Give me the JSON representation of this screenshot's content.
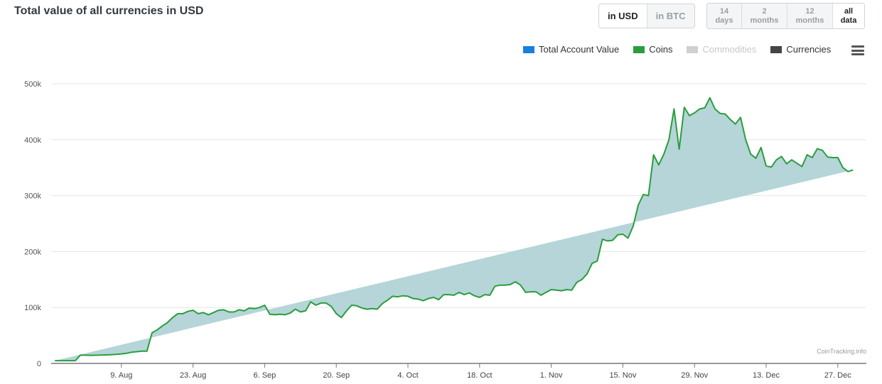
{
  "header": {
    "title": "Total value of all currencies in USD"
  },
  "currency_toggle": [
    {
      "label": "in USD",
      "active": true
    },
    {
      "label": "in BTC",
      "active": false
    }
  ],
  "range_buttons": [
    {
      "line1": "14",
      "line2": "days",
      "active": false
    },
    {
      "line1": "2",
      "line2": "months",
      "active": false
    },
    {
      "line1": "12",
      "line2": "months",
      "active": false
    },
    {
      "line1": "all",
      "line2": "data",
      "active": true
    }
  ],
  "legend": [
    {
      "label": "Total Account Value",
      "color": "#1a7fe0",
      "enabled": true
    },
    {
      "label": "Coins",
      "color": "#2a9d3e",
      "enabled": true
    },
    {
      "label": "Commodities",
      "color": "#d0d0d0",
      "enabled": false
    },
    {
      "label": "Currencies",
      "color": "#444444",
      "enabled": true
    }
  ],
  "credits": "CoinTracking.info",
  "chart_data": {
    "type": "area",
    "ylim": [
      0,
      500000
    ],
    "y_ticks": [
      0,
      100000,
      200000,
      300000,
      400000,
      500000
    ],
    "y_tick_labels": [
      "0",
      "100k",
      "200k",
      "300k",
      "400k",
      "500k"
    ],
    "x_tick_labels": [
      "9. Aug",
      "23. Aug",
      "6. Sep",
      "20. Sep",
      "4. Oct",
      "18. Oct",
      "1. Nov",
      "15. Nov",
      "29. Nov",
      "13. Dec",
      "27. Dec"
    ],
    "x_tick_days": [
      14,
      28,
      42,
      56,
      70,
      84,
      98,
      112,
      126,
      140,
      154
    ],
    "xlim_days": [
      0,
      157
    ],
    "grid": true,
    "line_color": "#2a9d3e",
    "fill_color": "#b5d5d8",
    "series": [
      {
        "name": "Coins",
        "x_days": [
          1,
          3,
          5,
          6,
          8,
          10,
          12,
          14,
          15,
          16,
          17,
          18,
          19,
          20,
          21,
          22,
          23,
          24,
          25,
          26,
          27,
          28,
          29,
          30,
          31,
          32,
          33,
          34,
          35,
          36,
          37,
          38,
          39,
          40,
          41,
          42,
          43,
          44,
          45,
          46,
          47,
          48,
          49,
          50,
          51,
          52,
          53,
          54,
          55,
          56,
          57,
          58,
          59,
          60,
          61,
          62,
          63,
          64,
          65,
          66,
          67,
          68,
          69,
          70,
          71,
          72,
          73,
          74,
          75,
          76,
          77,
          78,
          79,
          80,
          81,
          82,
          83,
          84,
          85,
          86,
          87,
          88,
          89,
          90,
          91,
          92,
          93,
          94,
          95,
          96,
          97,
          98,
          99,
          100,
          101,
          102,
          103,
          104,
          105,
          106,
          107,
          108,
          109,
          110,
          111,
          112,
          113,
          114,
          115,
          116,
          117,
          118,
          119,
          120,
          121,
          122,
          123,
          124,
          125,
          126,
          127,
          128,
          129,
          130,
          131,
          132,
          133,
          134,
          135,
          136,
          137,
          138,
          139,
          140,
          141,
          142,
          143,
          144,
          145,
          146,
          147,
          148,
          149,
          150,
          151,
          152,
          153,
          154,
          155,
          156,
          157
        ],
        "values": [
          5000,
          5000,
          5000,
          15000,
          14500,
          15000,
          15500,
          17000,
          18000,
          20000,
          21000,
          22000,
          22000,
          55000,
          60000,
          67000,
          73000,
          82000,
          89000,
          89000,
          93000,
          95000,
          89000,
          91000,
          87000,
          91000,
          95000,
          96000,
          92000,
          92000,
          96000,
          94000,
          99000,
          98000,
          100000,
          104000,
          88000,
          87000,
          88000,
          87000,
          90000,
          97000,
          92000,
          94000,
          110000,
          104000,
          108000,
          108000,
          102000,
          89000,
          82000,
          94000,
          104000,
          103000,
          99000,
          97000,
          98000,
          97000,
          107000,
          113000,
          120000,
          119000,
          121000,
          120000,
          116000,
          115000,
          112000,
          116000,
          118000,
          114000,
          123000,
          123000,
          122000,
          127000,
          123000,
          126000,
          121000,
          118000,
          123000,
          122000,
          138000,
          140000,
          140000,
          141000,
          146000,
          140000,
          127000,
          128000,
          128000,
          122000,
          127000,
          132000,
          131000,
          130000,
          132000,
          131000,
          145000,
          150000,
          160000,
          179000,
          183000,
          222000,
          219000,
          220000,
          230000,
          231000,
          224000,
          245000,
          283000,
          302000,
          300000,
          373000,
          355000,
          374000,
          400000,
          455000,
          383000,
          458000,
          443000,
          448000,
          455000,
          457000,
          475000,
          455000,
          447000,
          446000,
          436000,
          428000,
          440000,
          400000,
          374000,
          367000,
          386000,
          353000,
          351000,
          364000,
          370000,
          357000,
          364000,
          358000,
          352000,
          373000,
          368000,
          384000,
          381000,
          369000,
          368000,
          368000,
          350000,
          343000,
          346000,
          345000
        ]
      }
    ]
  }
}
